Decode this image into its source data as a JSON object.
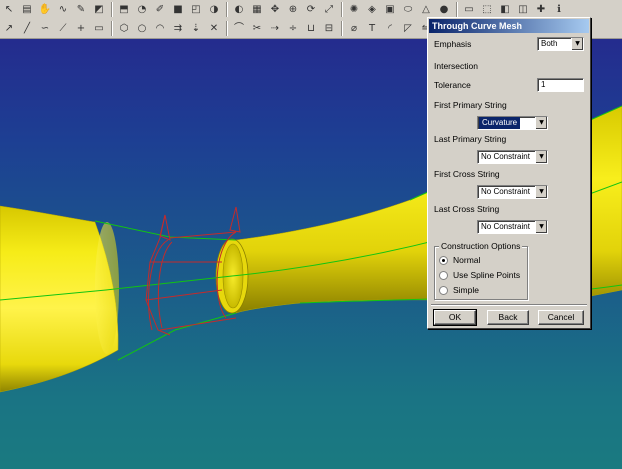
{
  "dialog": {
    "title": "Through Curve Mesh",
    "emphasis": {
      "label": "Emphasis",
      "value": "Both"
    },
    "intersection_label": "Intersection",
    "tolerance": {
      "label": "Tolerance",
      "value": "1"
    },
    "first_primary": {
      "label": "First Primary String",
      "value": "Curvature"
    },
    "last_primary": {
      "label": "Last Primary String",
      "value": "No Constraint"
    },
    "first_cross": {
      "label": "First Cross String",
      "value": "No Constraint"
    },
    "last_cross": {
      "label": "Last Cross String",
      "value": "No Constraint"
    },
    "construction": {
      "legend": "Construction Options",
      "options": [
        "Normal",
        "Use Spline Points",
        "Simple"
      ],
      "selected": "Normal"
    },
    "buttons": {
      "ok": "OK",
      "back": "Back",
      "cancel": "Cancel"
    }
  },
  "toolbar_icons": {
    "row1": [
      "select-icon",
      "layer-icon",
      "hand-icon",
      "curve-icon",
      "sketch-icon",
      "surface-icon",
      "feature-icon",
      "blend-icon",
      "edit-icon",
      "solid-icon",
      "view-icon",
      "shade-icon",
      "render-icon",
      "grid-icon",
      "pan-icon",
      "zoom-icon",
      "rotate-icon",
      "fit-icon",
      "light-icon",
      "material-icon",
      "cube-icon",
      "cylinder-icon",
      "cone-icon",
      "sphere-icon",
      "display-icon",
      "wireframe-icon",
      "shaded-icon",
      "hidden-icon",
      "snap-icon",
      "info-icon"
    ],
    "row2": [
      "arrow-icon",
      "line-icon",
      "spline-icon",
      "polyline-icon",
      "point-icon",
      "rectangle-icon",
      "polygon-icon",
      "circle-icon",
      "arc-icon",
      "offset-icon",
      "project-icon",
      "intersect-icon",
      "bridge-icon",
      "trim-icon",
      "extend-icon",
      "divide-icon",
      "join-icon",
      "section-icon",
      "helix-icon",
      "text-icon",
      "fillet-icon",
      "chamfer-icon",
      "mirror-icon",
      "copy-icon",
      "pattern-icon",
      "measure-icon"
    ]
  },
  "colors": {
    "surface": "#f2e814",
    "surface_shadow": "#8f8400",
    "guide_lines": "#12c412",
    "section_curves": "#c42b2b",
    "annotation_ellipse": "#e0203a",
    "dialog_title": "#0a246a"
  }
}
